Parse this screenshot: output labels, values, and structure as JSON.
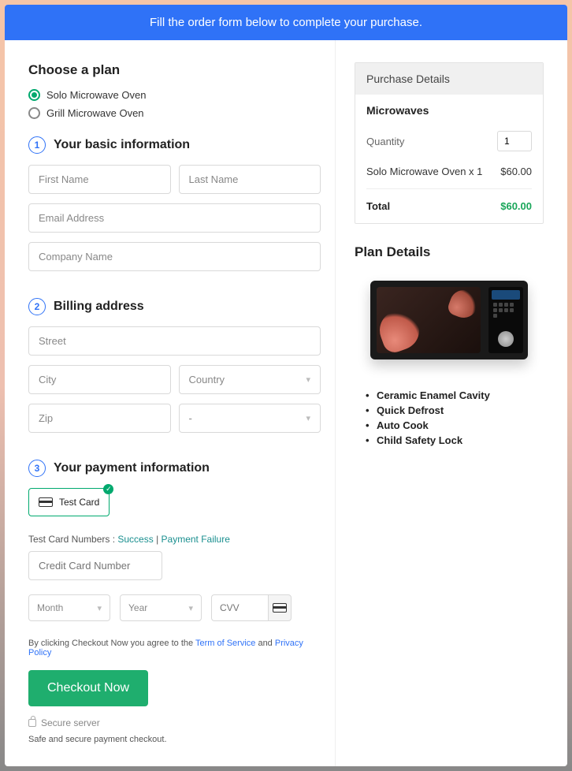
{
  "banner": "Fill the order form below to complete your purchase.",
  "left": {
    "choose_title": "Choose a plan",
    "plans": [
      "Solo Microwave Oven",
      "Grill Microwave Oven"
    ],
    "selected_plan": 0,
    "sec1": {
      "num": "1",
      "title": "Your basic information"
    },
    "basic": {
      "first_ph": "First Name",
      "last_ph": "Last Name",
      "email_ph": "Email Address",
      "company_ph": "Company Name"
    },
    "sec2": {
      "num": "2",
      "title": "Billing address"
    },
    "billing": {
      "street_ph": "Street",
      "city_ph": "City",
      "country_ph": "Country",
      "zip_ph": "Zip",
      "state_ph": "-"
    },
    "sec3": {
      "num": "3",
      "title": "Your payment information"
    },
    "testcard": "Test Card",
    "tc_prefix": "Test Card Numbers : ",
    "tc_success": "Success",
    "tc_sep": " | ",
    "tc_failure": "Payment Failure",
    "cc_ph": "Credit Card Number",
    "month_ph": "Month",
    "year_ph": "Year",
    "cvv_ph": "CVV",
    "terms_prefix": "By clicking Checkout Now you agree to the ",
    "tos": "Term of Service",
    "and": " and ",
    "pp": "Privacy Policy",
    "checkout": "Checkout Now",
    "secure": "Secure server",
    "safe": "Safe and secure payment checkout."
  },
  "right": {
    "pd_head": "Purchase Details",
    "prod": "Microwaves",
    "qty_label": "Quantity",
    "qty_val": "1",
    "line_name": "Solo Microwave Oven x 1",
    "line_price": "$60.00",
    "total_label": "Total",
    "total_val": "$60.00",
    "plan_h": "Plan Details",
    "features": [
      "Ceramic Enamel Cavity",
      "Quick Defrost",
      "Auto Cook",
      "Child Safety Lock"
    ]
  }
}
